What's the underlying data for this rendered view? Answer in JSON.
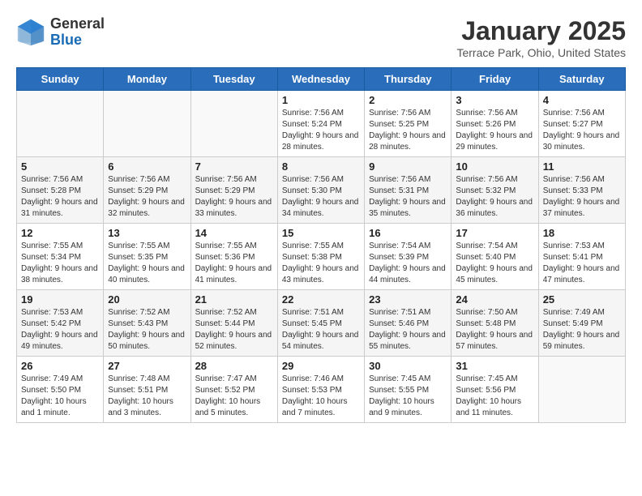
{
  "header": {
    "logo_line1": "General",
    "logo_line2": "Blue",
    "month": "January 2025",
    "location": "Terrace Park, Ohio, United States"
  },
  "weekdays": [
    "Sunday",
    "Monday",
    "Tuesday",
    "Wednesday",
    "Thursday",
    "Friday",
    "Saturday"
  ],
  "weeks": [
    [
      {
        "day": "",
        "sunrise": "",
        "sunset": "",
        "daylight": ""
      },
      {
        "day": "",
        "sunrise": "",
        "sunset": "",
        "daylight": ""
      },
      {
        "day": "",
        "sunrise": "",
        "sunset": "",
        "daylight": ""
      },
      {
        "day": "1",
        "sunrise": "Sunrise: 7:56 AM",
        "sunset": "Sunset: 5:24 PM",
        "daylight": "Daylight: 9 hours and 28 minutes."
      },
      {
        "day": "2",
        "sunrise": "Sunrise: 7:56 AM",
        "sunset": "Sunset: 5:25 PM",
        "daylight": "Daylight: 9 hours and 28 minutes."
      },
      {
        "day": "3",
        "sunrise": "Sunrise: 7:56 AM",
        "sunset": "Sunset: 5:26 PM",
        "daylight": "Daylight: 9 hours and 29 minutes."
      },
      {
        "day": "4",
        "sunrise": "Sunrise: 7:56 AM",
        "sunset": "Sunset: 5:27 PM",
        "daylight": "Daylight: 9 hours and 30 minutes."
      }
    ],
    [
      {
        "day": "5",
        "sunrise": "Sunrise: 7:56 AM",
        "sunset": "Sunset: 5:28 PM",
        "daylight": "Daylight: 9 hours and 31 minutes."
      },
      {
        "day": "6",
        "sunrise": "Sunrise: 7:56 AM",
        "sunset": "Sunset: 5:29 PM",
        "daylight": "Daylight: 9 hours and 32 minutes."
      },
      {
        "day": "7",
        "sunrise": "Sunrise: 7:56 AM",
        "sunset": "Sunset: 5:29 PM",
        "daylight": "Daylight: 9 hours and 33 minutes."
      },
      {
        "day": "8",
        "sunrise": "Sunrise: 7:56 AM",
        "sunset": "Sunset: 5:30 PM",
        "daylight": "Daylight: 9 hours and 34 minutes."
      },
      {
        "day": "9",
        "sunrise": "Sunrise: 7:56 AM",
        "sunset": "Sunset: 5:31 PM",
        "daylight": "Daylight: 9 hours and 35 minutes."
      },
      {
        "day": "10",
        "sunrise": "Sunrise: 7:56 AM",
        "sunset": "Sunset: 5:32 PM",
        "daylight": "Daylight: 9 hours and 36 minutes."
      },
      {
        "day": "11",
        "sunrise": "Sunrise: 7:56 AM",
        "sunset": "Sunset: 5:33 PM",
        "daylight": "Daylight: 9 hours and 37 minutes."
      }
    ],
    [
      {
        "day": "12",
        "sunrise": "Sunrise: 7:55 AM",
        "sunset": "Sunset: 5:34 PM",
        "daylight": "Daylight: 9 hours and 38 minutes."
      },
      {
        "day": "13",
        "sunrise": "Sunrise: 7:55 AM",
        "sunset": "Sunset: 5:35 PM",
        "daylight": "Daylight: 9 hours and 40 minutes."
      },
      {
        "day": "14",
        "sunrise": "Sunrise: 7:55 AM",
        "sunset": "Sunset: 5:36 PM",
        "daylight": "Daylight: 9 hours and 41 minutes."
      },
      {
        "day": "15",
        "sunrise": "Sunrise: 7:55 AM",
        "sunset": "Sunset: 5:38 PM",
        "daylight": "Daylight: 9 hours and 43 minutes."
      },
      {
        "day": "16",
        "sunrise": "Sunrise: 7:54 AM",
        "sunset": "Sunset: 5:39 PM",
        "daylight": "Daylight: 9 hours and 44 minutes."
      },
      {
        "day": "17",
        "sunrise": "Sunrise: 7:54 AM",
        "sunset": "Sunset: 5:40 PM",
        "daylight": "Daylight: 9 hours and 45 minutes."
      },
      {
        "day": "18",
        "sunrise": "Sunrise: 7:53 AM",
        "sunset": "Sunset: 5:41 PM",
        "daylight": "Daylight: 9 hours and 47 minutes."
      }
    ],
    [
      {
        "day": "19",
        "sunrise": "Sunrise: 7:53 AM",
        "sunset": "Sunset: 5:42 PM",
        "daylight": "Daylight: 9 hours and 49 minutes."
      },
      {
        "day": "20",
        "sunrise": "Sunrise: 7:52 AM",
        "sunset": "Sunset: 5:43 PM",
        "daylight": "Daylight: 9 hours and 50 minutes."
      },
      {
        "day": "21",
        "sunrise": "Sunrise: 7:52 AM",
        "sunset": "Sunset: 5:44 PM",
        "daylight": "Daylight: 9 hours and 52 minutes."
      },
      {
        "day": "22",
        "sunrise": "Sunrise: 7:51 AM",
        "sunset": "Sunset: 5:45 PM",
        "daylight": "Daylight: 9 hours and 54 minutes."
      },
      {
        "day": "23",
        "sunrise": "Sunrise: 7:51 AM",
        "sunset": "Sunset: 5:46 PM",
        "daylight": "Daylight: 9 hours and 55 minutes."
      },
      {
        "day": "24",
        "sunrise": "Sunrise: 7:50 AM",
        "sunset": "Sunset: 5:48 PM",
        "daylight": "Daylight: 9 hours and 57 minutes."
      },
      {
        "day": "25",
        "sunrise": "Sunrise: 7:49 AM",
        "sunset": "Sunset: 5:49 PM",
        "daylight": "Daylight: 9 hours and 59 minutes."
      }
    ],
    [
      {
        "day": "26",
        "sunrise": "Sunrise: 7:49 AM",
        "sunset": "Sunset: 5:50 PM",
        "daylight": "Daylight: 10 hours and 1 minute."
      },
      {
        "day": "27",
        "sunrise": "Sunrise: 7:48 AM",
        "sunset": "Sunset: 5:51 PM",
        "daylight": "Daylight: 10 hours and 3 minutes."
      },
      {
        "day": "28",
        "sunrise": "Sunrise: 7:47 AM",
        "sunset": "Sunset: 5:52 PM",
        "daylight": "Daylight: 10 hours and 5 minutes."
      },
      {
        "day": "29",
        "sunrise": "Sunrise: 7:46 AM",
        "sunset": "Sunset: 5:53 PM",
        "daylight": "Daylight: 10 hours and 7 minutes."
      },
      {
        "day": "30",
        "sunrise": "Sunrise: 7:45 AM",
        "sunset": "Sunset: 5:55 PM",
        "daylight": "Daylight: 10 hours and 9 minutes."
      },
      {
        "day": "31",
        "sunrise": "Sunrise: 7:45 AM",
        "sunset": "Sunset: 5:56 PM",
        "daylight": "Daylight: 10 hours and 11 minutes."
      },
      {
        "day": "",
        "sunrise": "",
        "sunset": "",
        "daylight": ""
      }
    ]
  ]
}
